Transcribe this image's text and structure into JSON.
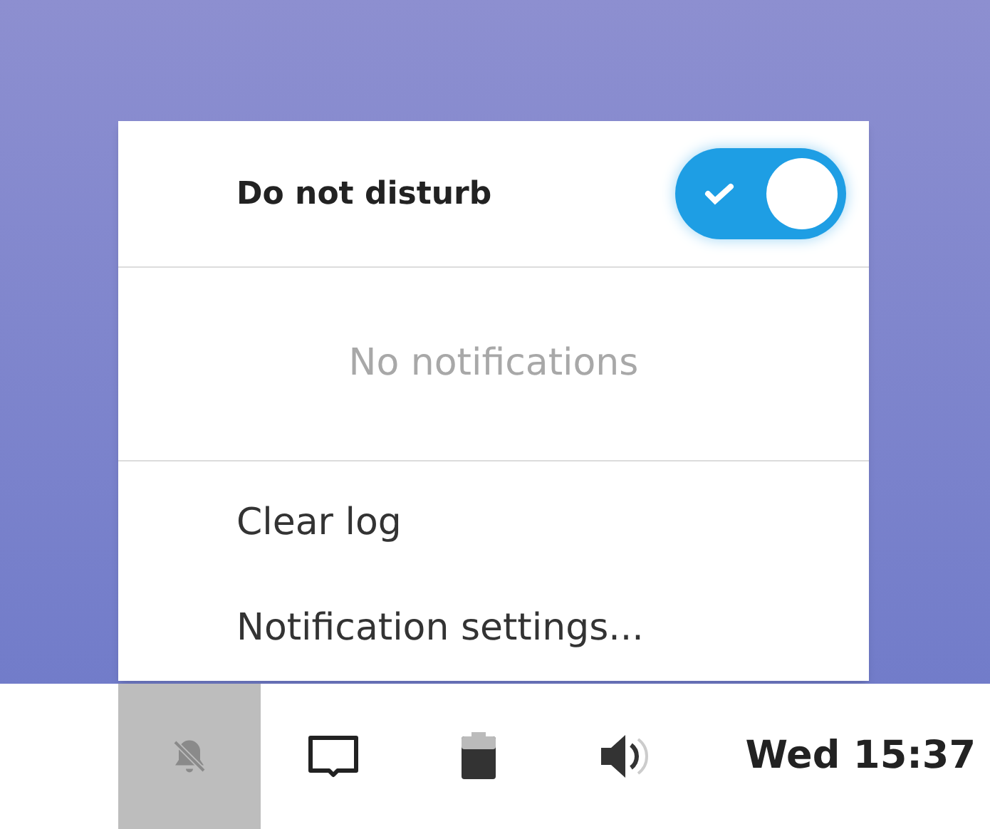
{
  "notification_popover": {
    "do_not_disturb": {
      "label": "Do not disturb",
      "on": true
    },
    "empty_message": "No notifications",
    "menu_items": [
      "Clear log",
      "Notification settings..."
    ]
  },
  "taskbar": {
    "items": [
      {
        "kind": "notifications",
        "selected": true
      },
      {
        "kind": "display",
        "selected": false
      },
      {
        "kind": "battery",
        "selected": false
      },
      {
        "kind": "volume",
        "selected": false
      }
    ],
    "clock": "Wed 15:37"
  }
}
